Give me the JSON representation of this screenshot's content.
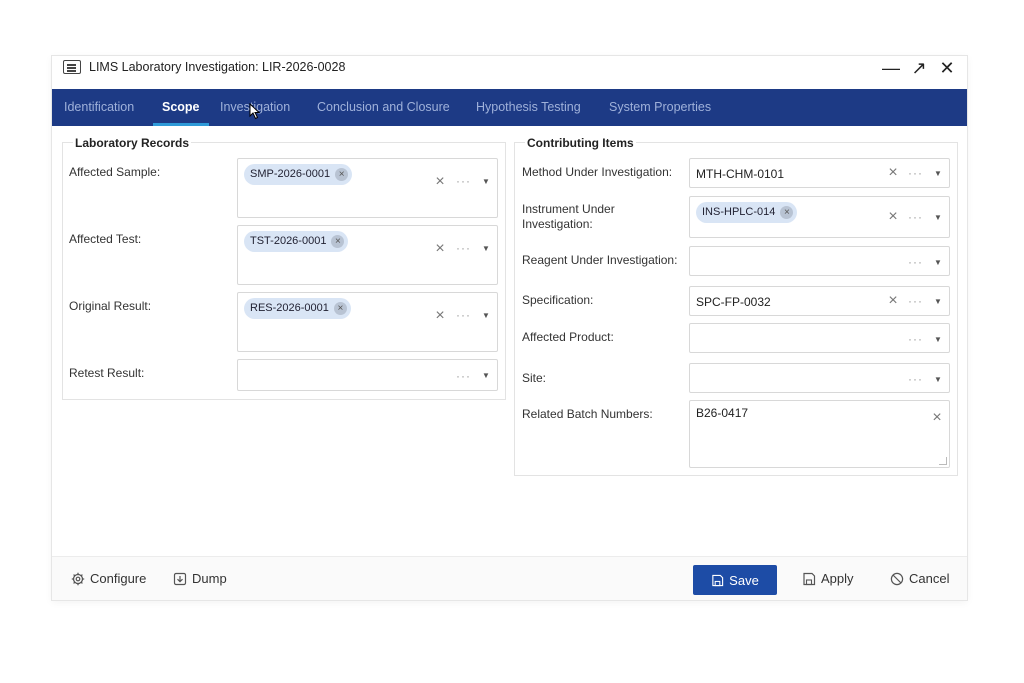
{
  "window": {
    "title": "LIMS Laboratory Investigation: LIR-2026-0028",
    "minimize_glyph": "—",
    "maximize_glyph": "↗",
    "close_glyph": "✕"
  },
  "tabs": [
    {
      "label": "Identification"
    },
    {
      "label": "Scope",
      "active": true
    },
    {
      "label": "Investigation"
    },
    {
      "label": "Conclusion and Closure"
    },
    {
      "label": "Hypothesis Testing"
    },
    {
      "label": "System Properties"
    }
  ],
  "lab_records": {
    "title": "Laboratory Records",
    "affected_sample": {
      "label": "Affected Sample:",
      "chip": "SMP-2026-0001"
    },
    "affected_test": {
      "label": "Affected Test:",
      "chip": "TST-2026-0001"
    },
    "original_result": {
      "label": "Original Result:",
      "chip": "RES-2026-0001"
    },
    "retest_result": {
      "label": "Retest Result:",
      "value": ""
    }
  },
  "contributing": {
    "title": "Contributing Items",
    "method": {
      "label": "Method Under Investigation:",
      "value": "MTH-CHM-0101"
    },
    "instrument": {
      "label": "Instrument Under Investigation:",
      "chip": "INS-HPLC-014"
    },
    "reagent": {
      "label": "Reagent Under Investigation:",
      "value": ""
    },
    "specification": {
      "label": "Specification:",
      "value": "SPC-FP-0032"
    },
    "affected_product": {
      "label": "Affected Product:",
      "value": ""
    },
    "site": {
      "label": "Site:",
      "value": ""
    },
    "batch_numbers": {
      "label": "Related Batch Numbers:",
      "value": "B26-0417"
    }
  },
  "glyphs": {
    "clear": "×",
    "dots": "···",
    "caret": "▼",
    "chip_remove": "×"
  },
  "footer": {
    "configure": "Configure",
    "dump": "Dump",
    "save": "Save",
    "apply": "Apply",
    "cancel": "Cancel"
  },
  "colors": {
    "tabbar": "#1d3a85",
    "tab_active_underline": "#2e9ad8",
    "save_button": "#1d4ca6",
    "chip": "#d9e5f5"
  }
}
